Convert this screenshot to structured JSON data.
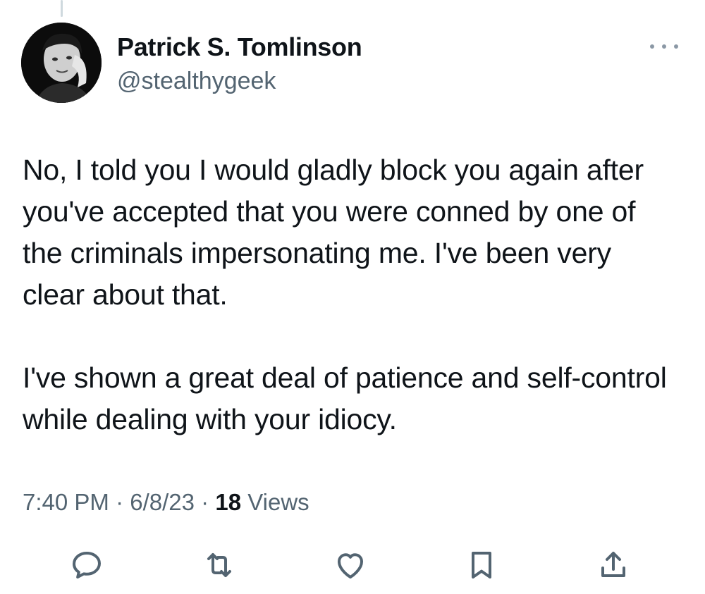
{
  "author": {
    "display_name": "Patrick S. Tomlinson",
    "handle": "@stealthygeek",
    "avatar_icon": "profile-photo"
  },
  "more_icon": "more-horizontal-icon",
  "tweet": {
    "paragraphs": [
      "No, I told you I would gladly block you again after you've accepted that you were conned by one of the criminals impersonating me. I've been very clear about that.",
      "I've shown a great deal of patience and self-control while dealing with your idiocy."
    ]
  },
  "meta": {
    "time": "7:40 PM",
    "separator": "·",
    "date": "6/8/23",
    "views_count": "18",
    "views_label": "Views"
  },
  "actions": [
    {
      "name": "reply",
      "icon": "reply-icon"
    },
    {
      "name": "retweet",
      "icon": "retweet-icon"
    },
    {
      "name": "like",
      "icon": "heart-icon"
    },
    {
      "name": "bookmark",
      "icon": "bookmark-icon"
    },
    {
      "name": "share",
      "icon": "share-icon"
    }
  ],
  "colors": {
    "text_primary": "#0f1419",
    "text_secondary": "#536471",
    "icon": "#536471"
  }
}
